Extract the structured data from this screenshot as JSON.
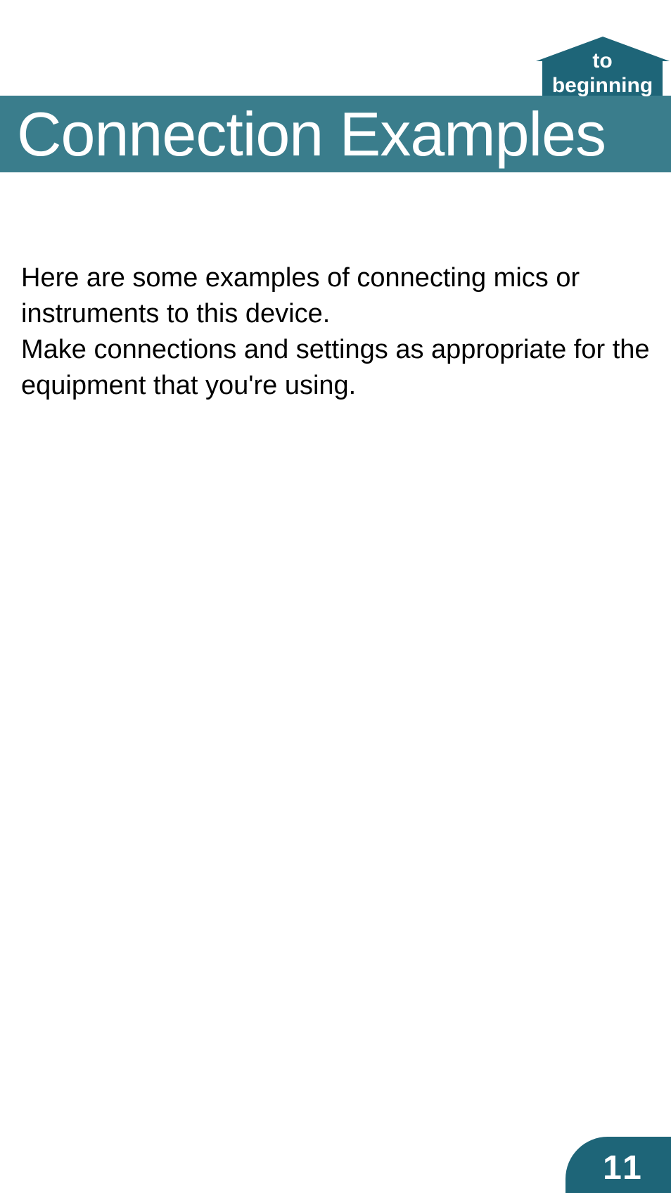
{
  "nav": {
    "to_beginning_line1": "to",
    "to_beginning_line2": "beginning"
  },
  "header": {
    "title": "Connection Examples"
  },
  "body": {
    "paragraph1": "Here are some examples of connecting mics or instruments to this device.",
    "paragraph2": "Make connections and settings as appropriate for the equipment that you're using."
  },
  "footer": {
    "page_number": "11"
  },
  "colors": {
    "teal_dark": "#1e6578",
    "teal_mid": "#3a7d8c"
  }
}
